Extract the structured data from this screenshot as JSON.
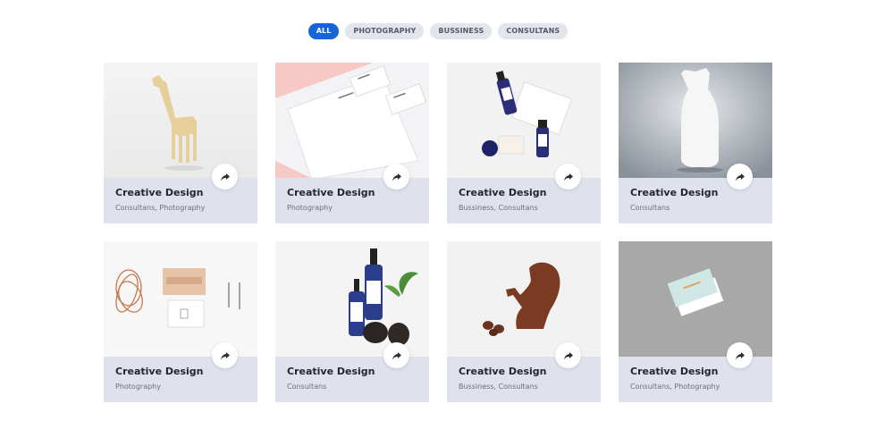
{
  "filters": [
    {
      "label": "ALL",
      "active": true
    },
    {
      "label": "PHOTOGRAPHY",
      "active": false
    },
    {
      "label": "BUSSINESS",
      "active": false
    },
    {
      "label": "CONSULTANS",
      "active": false
    }
  ],
  "cards": [
    {
      "title": "Creative Design",
      "categories": "Consultans, Photography",
      "image": "giraffe-figurine"
    },
    {
      "title": "Creative Design",
      "categories": "Photography",
      "image": "stationery-mockup"
    },
    {
      "title": "Creative Design",
      "categories": "Bussiness, Consultans",
      "image": "cosmetic-bottles"
    },
    {
      "title": "Creative Design",
      "categories": "Consultans",
      "image": "white-vase"
    },
    {
      "title": "Creative Design",
      "categories": "Photography",
      "image": "desk-items"
    },
    {
      "title": "Creative Design",
      "categories": "Consultans",
      "image": "pump-bottles"
    },
    {
      "title": "Creative Design",
      "categories": "Bussiness, Consultans",
      "image": "squirrel-figure"
    },
    {
      "title": "Creative Design",
      "categories": "Consultans, Photography",
      "image": "business-cards"
    }
  ],
  "colors": {
    "accent": "#1565d8",
    "pill": "#e3e5ec",
    "caption_bg": "#dfe1ec"
  },
  "icons": {
    "share": "share-arrow-icon"
  }
}
